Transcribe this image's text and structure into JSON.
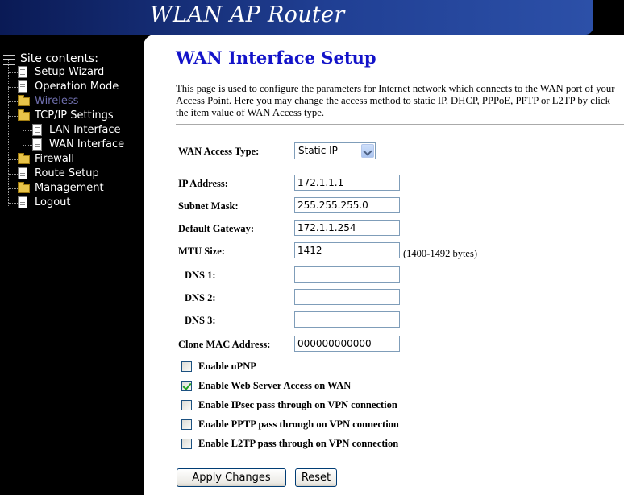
{
  "header": {
    "title": "WLAN AP Router"
  },
  "sidebar": {
    "root": "Site contents:",
    "items": [
      {
        "label": "Setup Wizard",
        "icon": "document-icon"
      },
      {
        "label": "Operation Mode",
        "icon": "document-icon"
      },
      {
        "label": "Wireless",
        "icon": "folder-icon",
        "disabled": true
      },
      {
        "label": "TCP/IP Settings",
        "icon": "open-folder-icon"
      },
      {
        "label": "LAN Interface",
        "icon": "document-icon"
      },
      {
        "label": "WAN Interface",
        "icon": "document-icon"
      },
      {
        "label": "Firewall",
        "icon": "folder-icon"
      },
      {
        "label": "Route Setup",
        "icon": "document-icon"
      },
      {
        "label": "Management",
        "icon": "folder-icon"
      },
      {
        "label": "Logout",
        "icon": "document-icon"
      }
    ]
  },
  "main": {
    "title": "WAN Interface Setup",
    "description": "This page is used to configure the parameters for Internet network which connects to the WAN port of your Access Point. Here you may change the access method to static IP, DHCP, PPPoE, PPTP or L2TP by click the item value of WAN Access type.",
    "access_type_label": "WAN Access Type:",
    "access_type_value": "Static IP",
    "fields": {
      "ip_label": "IP Address:",
      "ip_value": "172.1.1.1",
      "mask_label": "Subnet Mask:",
      "mask_value": "255.255.255.0",
      "gw_label": "Default Gateway:",
      "gw_value": "172.1.1.254",
      "mtu_label": "MTU Size:",
      "mtu_value": "1412",
      "mtu_note": "(1400-1492 bytes)",
      "dns1_label": "DNS 1:",
      "dns1_value": "",
      "dns2_label": "DNS 2:",
      "dns2_value": "",
      "dns3_label": "DNS 3:",
      "dns3_value": "",
      "mac_label": "Clone MAC Address:",
      "mac_value": "000000000000"
    },
    "options": [
      {
        "label": "Enable uPNP",
        "checked": false
      },
      {
        "label": "Enable Web Server Access on WAN",
        "checked": true
      },
      {
        "label": "Enable IPsec pass through on VPN connection",
        "checked": false
      },
      {
        "label": "Enable PPTP pass through on VPN connection",
        "checked": false
      },
      {
        "label": "Enable L2TP pass through on VPN connection",
        "checked": false
      }
    ],
    "buttons": {
      "apply": "Apply Changes",
      "reset": "Reset"
    }
  },
  "colors": {
    "title_blue": "#1313c9",
    "header_blue": "#203f93",
    "sidebar_bg": "#000000",
    "disabled_item": "#6f6fae"
  }
}
